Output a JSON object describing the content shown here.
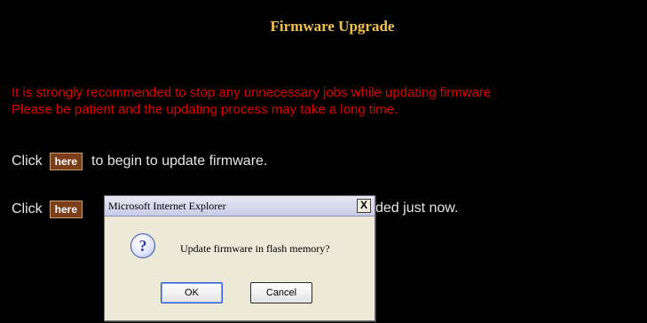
{
  "page": {
    "title": "Firmware Upgrade",
    "warning_line1": "It is strongly recommended to stop any unnecessary jobs while updating firmware",
    "warning_line2": "Please be patient and the updating process may take a long time."
  },
  "actions": {
    "click_label": "Click",
    "here_label": "here",
    "row1_text": "to begin to update firmware.",
    "row2_tail": "ded just now."
  },
  "dialog": {
    "title": "Microsoft Internet Explorer",
    "close_label": "X",
    "icon_glyph": "?",
    "message": "Update firmware in flash memory?",
    "ok_label": "OK",
    "cancel_label": "Cancel"
  },
  "colors": {
    "title": "#f2c14e",
    "warning": "#e00000",
    "here_button": "#7a3e1a"
  }
}
